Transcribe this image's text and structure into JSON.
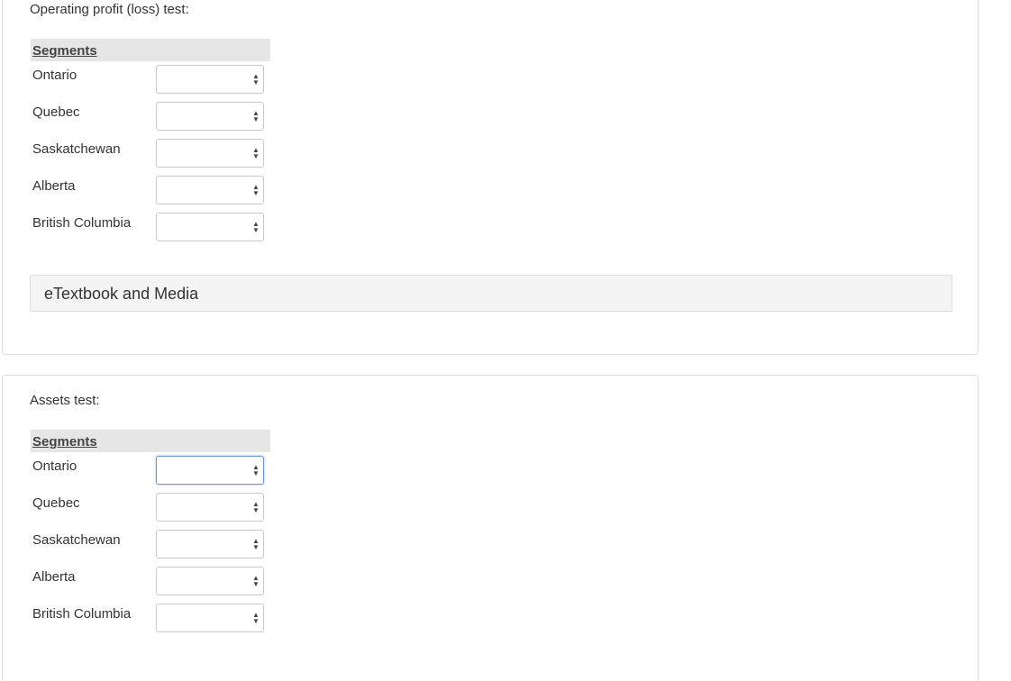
{
  "operating_test": {
    "title": "Operating profit (loss) test:",
    "segments_header": "Segments",
    "rows": [
      {
        "label": "Ontario",
        "value": ""
      },
      {
        "label": "Quebec",
        "value": ""
      },
      {
        "label": "Saskatchewan",
        "value": ""
      },
      {
        "label": "Alberta",
        "value": ""
      },
      {
        "label": "British Columbia",
        "value": ""
      }
    ]
  },
  "media": {
    "label": "eTextbook and Media"
  },
  "assets_test": {
    "title": "Assets test:",
    "segments_header": "Segments",
    "rows": [
      {
        "label": "Ontario",
        "value": ""
      },
      {
        "label": "Quebec",
        "value": ""
      },
      {
        "label": "Saskatchewan",
        "value": ""
      },
      {
        "label": "Alberta",
        "value": ""
      },
      {
        "label": "British Columbia",
        "value": ""
      }
    ]
  },
  "icons": {
    "select_caret": "up-down-caret-icon"
  },
  "colors": {
    "header_bg": "#e6e6e6",
    "focus_border": "#6a9ad8",
    "media_bg": "#f4f4f4"
  }
}
